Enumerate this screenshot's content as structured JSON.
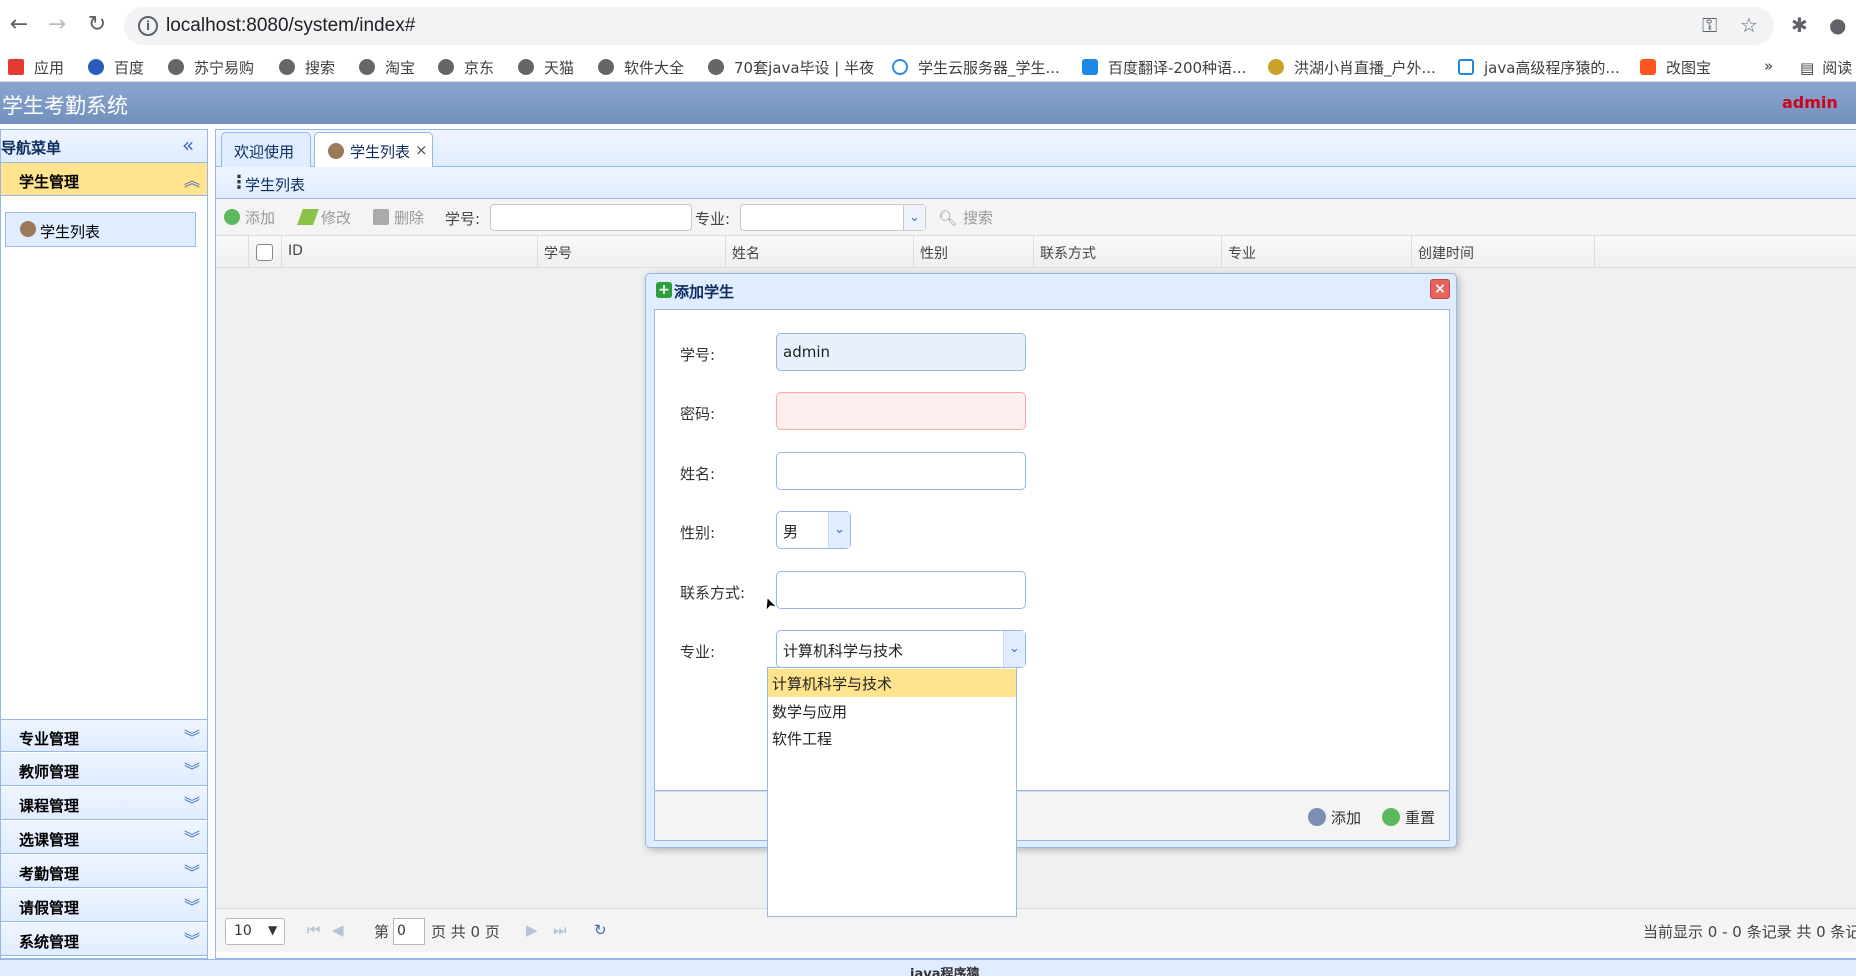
{
  "browser": {
    "url": "localhost:8080/system/index#",
    "bookmarks": [
      {
        "label": "应用",
        "icon": "apps-icon"
      },
      {
        "label": "百度",
        "icon": "baidu-icon"
      },
      {
        "label": "苏宁易购",
        "icon": "globe-icon"
      },
      {
        "label": "搜索",
        "icon": "globe-icon"
      },
      {
        "label": "淘宝",
        "icon": "globe-icon"
      },
      {
        "label": "京东",
        "icon": "globe-icon"
      },
      {
        "label": "天猫",
        "icon": "globe-icon"
      },
      {
        "label": "软件大全",
        "icon": "globe-icon"
      },
      {
        "label": "70套java毕设 | 半夜",
        "icon": "globe-icon"
      },
      {
        "label": "学生云服务器_学生...",
        "icon": "cloud-icon"
      },
      {
        "label": "百度翻译-200种语...",
        "icon": "translate-icon"
      },
      {
        "label": "洪湖小肖直播_户外...",
        "icon": "live-icon"
      },
      {
        "label": "java高级程序猿的...",
        "icon": "tv-icon"
      },
      {
        "label": "改图宝",
        "icon": "image-icon"
      }
    ],
    "more_bookmarks": "»",
    "reading_list": "阅读"
  },
  "app": {
    "title": "学生考勤系统",
    "user": "admin"
  },
  "sidebar": {
    "header": "导航菜单",
    "sections": [
      {
        "title": "学生管理",
        "active": true,
        "items": [
          "学生列表"
        ]
      },
      {
        "title": "专业管理"
      },
      {
        "title": "教师管理"
      },
      {
        "title": "课程管理"
      },
      {
        "title": "选课管理"
      },
      {
        "title": "考勤管理"
      },
      {
        "title": "请假管理"
      },
      {
        "title": "系统管理"
      }
    ]
  },
  "tabs": [
    {
      "label": "欢迎使用"
    },
    {
      "label": "学生列表",
      "active": true,
      "close": "×"
    }
  ],
  "panel": {
    "title": "学生列表"
  },
  "toolbar": {
    "add": "添加",
    "edit": "修改",
    "delete": "删除",
    "sn_label": "学号:",
    "major_label": "专业:",
    "search": "搜索"
  },
  "grid": {
    "columns": [
      "ID",
      "学号",
      "姓名",
      "性别",
      "联系方式",
      "专业",
      "创建时间"
    ]
  },
  "pager": {
    "page_size": "10",
    "page_prefix": "第",
    "page_value": "0",
    "page_suffix": "页 共 0 页",
    "info": "当前显示 0 - 0 条记录 共 0 条记"
  },
  "footer": {
    "text": "java程序猿"
  },
  "dialog": {
    "title": "添加学生",
    "fields": {
      "sn_label": "学号:",
      "sn_value": "admin",
      "password_label": "密码:",
      "password_value": "",
      "name_label": "姓名:",
      "name_value": "",
      "gender_label": "性别:",
      "gender_value": "男",
      "phone_label": "联系方式:",
      "phone_value": "",
      "major_label": "专业:",
      "major_value": "计算机科学与技术"
    },
    "buttons": {
      "add": "添加",
      "reset": "重置"
    }
  },
  "major_dropdown": {
    "options": [
      "计算机科学与技术",
      "数学与应用",
      "软件工程"
    ],
    "selected_index": 0
  }
}
